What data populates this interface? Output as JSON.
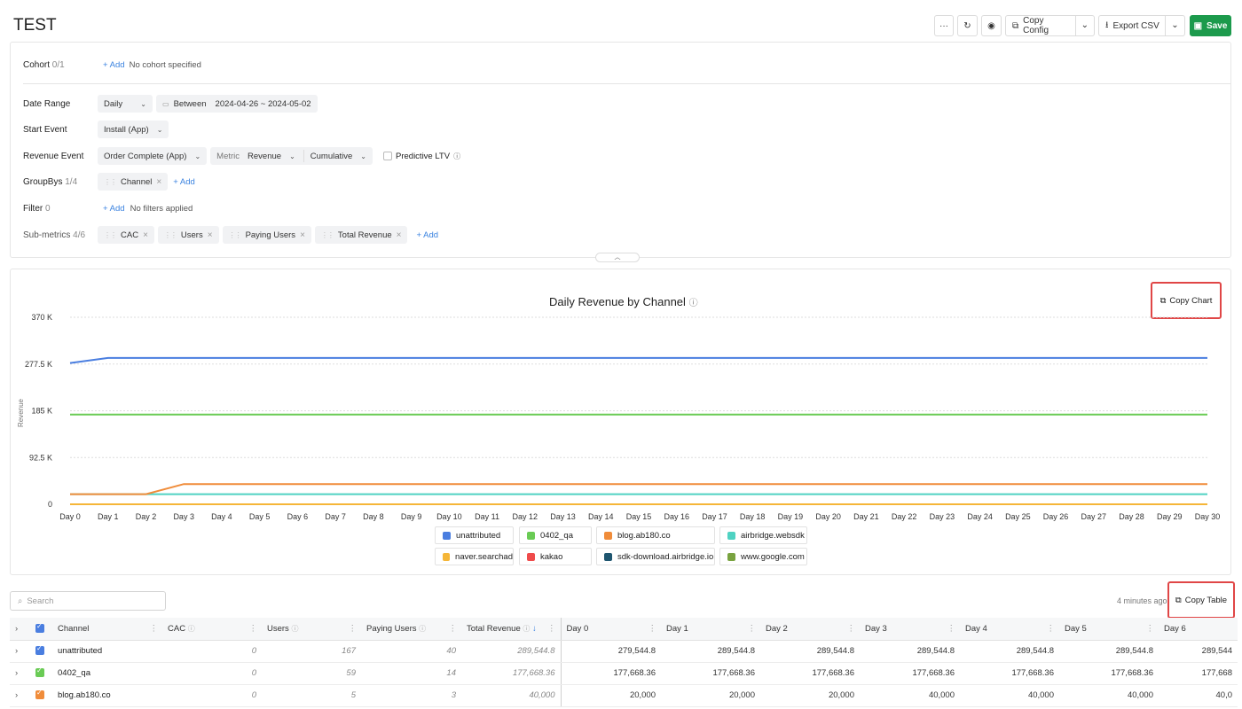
{
  "app": {
    "title": "TEST"
  },
  "toolbar": {
    "copy_config": "Copy Config",
    "export_csv": "Export CSV",
    "save": "Save",
    "more": "···",
    "refresh": "↻",
    "view": "◉"
  },
  "filters": {
    "cohort": {
      "label": "Cohort",
      "count": "0/1",
      "add": "+ Add",
      "value": "No cohort specified"
    },
    "date_range": {
      "label": "Date Range",
      "granularity": "Daily",
      "mode": "Between",
      "range": "2024-04-26 ~ 2024-05-02"
    },
    "start_event": {
      "label": "Start Event",
      "value": "Install (App)"
    },
    "revenue_event": {
      "label": "Revenue Event",
      "value": "Order Complete (App)",
      "metric_label": "Metric",
      "metric": "Revenue",
      "mode": "Cumulative",
      "predictive": "Predictive LTV"
    },
    "groupbys": {
      "label": "GroupBys",
      "count": "1/4",
      "chip": "Channel",
      "add": "+ Add"
    },
    "filter": {
      "label": "Filter",
      "count": "0",
      "add": "+ Add",
      "value": "No filters applied"
    },
    "submetrics": {
      "label": "Sub-metrics",
      "count": "4/6",
      "chips": [
        "CAC",
        "Users",
        "Paying Users",
        "Total Revenue"
      ],
      "add": "+ Add"
    }
  },
  "chart_data": {
    "type": "line",
    "title": "Daily Revenue by Channel",
    "xlabel": "",
    "ylabel": "Revenue",
    "ylim": [
      0,
      370000
    ],
    "yticks": [
      "0",
      "92.5 K",
      "185 K",
      "277.5 K",
      "370 K"
    ],
    "categories": [
      "Day 0",
      "Day 1",
      "Day 2",
      "Day 3",
      "Day 4",
      "Day 5",
      "Day 6",
      "Day 7",
      "Day 8",
      "Day 9",
      "Day 10",
      "Day 11",
      "Day 12",
      "Day 13",
      "Day 14",
      "Day 15",
      "Day 16",
      "Day 17",
      "Day 18",
      "Day 19",
      "Day 20",
      "Day 21",
      "Day 22",
      "Day 23",
      "Day 24",
      "Day 25",
      "Day 26",
      "Day 27",
      "Day 28",
      "Day 29",
      "Day 30"
    ],
    "series": [
      {
        "name": "unattributed",
        "color": "#4a7ee0",
        "values": [
          279544.8,
          289544.8,
          289544.8,
          289544.8,
          289544.8,
          289544.8,
          289544.8,
          289544.8,
          289544.8,
          289544.8,
          289544.8,
          289544.8,
          289544.8,
          289544.8,
          289544.8,
          289544.8,
          289544.8,
          289544.8,
          289544.8,
          289544.8,
          289544.8,
          289544.8,
          289544.8,
          289544.8,
          289544.8,
          289544.8,
          289544.8,
          289544.8,
          289544.8,
          289544.8,
          289544.8
        ]
      },
      {
        "name": "0402_qa",
        "color": "#6acb55",
        "values": [
          177668.36,
          177668.36,
          177668.36,
          177668.36,
          177668.36,
          177668.36,
          177668.36,
          177668.36,
          177668.36,
          177668.36,
          177668.36,
          177668.36,
          177668.36,
          177668.36,
          177668.36,
          177668.36,
          177668.36,
          177668.36,
          177668.36,
          177668.36,
          177668.36,
          177668.36,
          177668.36,
          177668.36,
          177668.36,
          177668.36,
          177668.36,
          177668.36,
          177668.36,
          177668.36,
          177668.36
        ]
      },
      {
        "name": "blog.ab180.co",
        "color": "#f08c3a",
        "values": [
          20000,
          20000,
          20000,
          40000,
          40000,
          40000,
          40000,
          40000,
          40000,
          40000,
          40000,
          40000,
          40000,
          40000,
          40000,
          40000,
          40000,
          40000,
          40000,
          40000,
          40000,
          40000,
          40000,
          40000,
          40000,
          40000,
          40000,
          40000,
          40000,
          40000,
          40000
        ]
      },
      {
        "name": "airbridge.websdk",
        "color": "#4fd2c2",
        "values": [
          20000,
          20000,
          20000,
          20000,
          20000,
          20000,
          20000,
          20000,
          20000,
          20000,
          20000,
          20000,
          20000,
          20000,
          20000,
          20000,
          20000,
          20000,
          20000,
          20000,
          20000,
          20000,
          20000,
          20000,
          20000,
          20000,
          20000,
          20000,
          20000,
          20000,
          20000
        ]
      },
      {
        "name": "naver.searchad",
        "color": "#f5b638",
        "values": [
          0,
          0,
          0,
          0,
          0,
          0,
          0,
          0,
          0,
          0,
          0,
          0,
          0,
          0,
          0,
          0,
          0,
          0,
          0,
          0,
          0,
          0,
          0,
          0,
          0,
          0,
          0,
          0,
          0,
          0,
          0
        ]
      },
      {
        "name": "kakao",
        "color": "#ef4b4b",
        "values": [
          0,
          0,
          0,
          0,
          0,
          0,
          0,
          0,
          0,
          0,
          0,
          0,
          0,
          0,
          0,
          0,
          0,
          0,
          0,
          0,
          0,
          0,
          0,
          0,
          0,
          0,
          0,
          0,
          0,
          0,
          0
        ]
      },
      {
        "name": "sdk-download.airbridge.io",
        "color": "#1f5670",
        "values": [
          0,
          0,
          0,
          0,
          0,
          0,
          0,
          0,
          0,
          0,
          0,
          0,
          0,
          0,
          0,
          0,
          0,
          0,
          0,
          0,
          0,
          0,
          0,
          0,
          0,
          0,
          0,
          0,
          0,
          0,
          0
        ]
      },
      {
        "name": "www.google.com",
        "color": "#79a340",
        "values": [
          0,
          0,
          0,
          0,
          0,
          0,
          0,
          0,
          0,
          0,
          0,
          0,
          0,
          0,
          0,
          0,
          0,
          0,
          0,
          0,
          0,
          0,
          0,
          0,
          0,
          0,
          0,
          0,
          0,
          0,
          0
        ]
      }
    ],
    "grid": true,
    "legend": "bottom"
  },
  "chart_actions": {
    "copy_chart": "Copy Chart"
  },
  "table": {
    "search_placeholder": "Search",
    "updated": "4 minutes ago",
    "copy_table": "Copy Table",
    "headers": [
      "Channel",
      "CAC",
      "Users",
      "Paying Users",
      "Total Revenue",
      "Day 0",
      "Day 1",
      "Day 2",
      "Day 3",
      "Day 4",
      "Day 5",
      "Day 6"
    ],
    "rows": [
      {
        "channel": "unattributed",
        "color": "#4a7ee0",
        "cells": [
          "0",
          "167",
          "40",
          "289,544.8",
          "279,544.8",
          "289,544.8",
          "289,544.8",
          "289,544.8",
          "289,544.8",
          "289,544.8",
          "289,544"
        ]
      },
      {
        "channel": "0402_qa",
        "color": "#6acb55",
        "cells": [
          "0",
          "59",
          "14",
          "177,668.36",
          "177,668.36",
          "177,668.36",
          "177,668.36",
          "177,668.36",
          "177,668.36",
          "177,668.36",
          "177,668"
        ]
      },
      {
        "channel": "blog.ab180.co",
        "color": "#f08c3a",
        "cells": [
          "0",
          "5",
          "3",
          "40,000",
          "20,000",
          "20,000",
          "20,000",
          "40,000",
          "40,000",
          "40,000",
          "40,0"
        ]
      }
    ]
  }
}
